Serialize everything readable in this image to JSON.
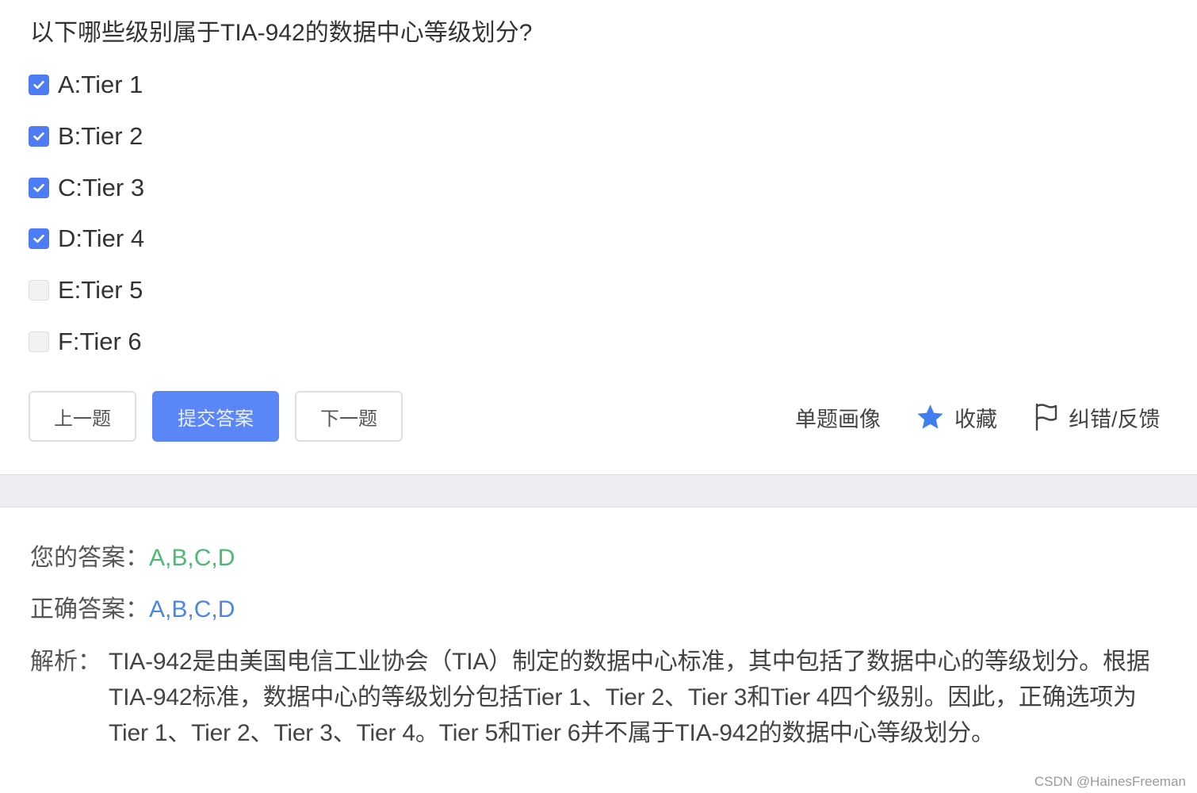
{
  "question": {
    "text": "以下哪些级别属于TIA-942的数据中心等级划分?"
  },
  "options": [
    {
      "label": "A:Tier 1",
      "checked": true
    },
    {
      "label": "B:Tier 2",
      "checked": true
    },
    {
      "label": "C:Tier 3",
      "checked": true
    },
    {
      "label": "D:Tier 4",
      "checked": true
    },
    {
      "label": "E:Tier 5",
      "checked": false
    },
    {
      "label": "F:Tier 6",
      "checked": false
    }
  ],
  "buttons": {
    "prev": "上一题",
    "submit": "提交答案",
    "next": "下一题"
  },
  "tools": {
    "portrait": "单题画像",
    "favorite": "收藏",
    "report": "纠错/反馈"
  },
  "result": {
    "your_answer_label": "您的答案：",
    "your_answer": "A,B,C,D",
    "correct_answer_label": "正确答案：",
    "correct_answer": "A,B,C,D",
    "analysis_label": "解析：",
    "analysis_text": "TIA-942是由美国电信工业协会（TIA）制定的数据中心标准，其中包括了数据中心的等级划分。根据TIA-942标准，数据中心的等级划分包括Tier 1、Tier 2、Tier 3和Tier 4四个级别。因此，正确选项为Tier 1、Tier 2、Tier 3、Tier 4。Tier 5和Tier 6并不属于TIA-942的数据中心等级划分。"
  },
  "watermark": "CSDN @HainesFreeman",
  "colors": {
    "primary": "#5a86f7",
    "checkbox_checked": "#4d7cf5",
    "your_answer": "#4cba73",
    "correct_answer": "#4a86e8",
    "star": "#3f7ff0"
  },
  "icons": {
    "favorite": "star-icon",
    "report": "flag-icon",
    "check": "check-icon"
  }
}
